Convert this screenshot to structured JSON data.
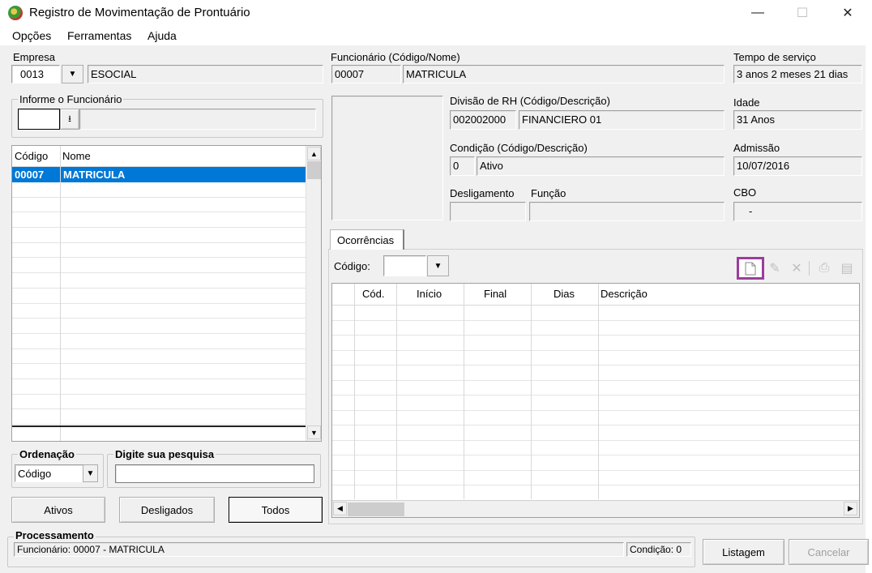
{
  "window": {
    "title": "Registro de Movimentação de Prontuário",
    "minimize": "—",
    "maximize": "☐",
    "close": "✕"
  },
  "menu": [
    "Opções",
    "Ferramentas",
    "Ajuda"
  ],
  "empresa": {
    "label": "Empresa",
    "code": "0013",
    "name": "ESOCIAL"
  },
  "informe": {
    "label": "Informe o Funcionário",
    "value": ""
  },
  "employee_list": {
    "headers": [
      "Código",
      "Nome"
    ],
    "rows": [
      {
        "codigo": "00007",
        "nome": "MATRICULA"
      }
    ]
  },
  "ordenacao": {
    "label": "Ordenação",
    "value": "Código"
  },
  "pesquisa": {
    "label": "Digite sua pesquisa",
    "value": ""
  },
  "filter_buttons": {
    "ativos": "Ativos",
    "desligados": "Desligados",
    "todos": "Todos"
  },
  "funcionario": {
    "label": "Funcionário (Código/Nome)",
    "code": "00007",
    "name": "MATRICULA"
  },
  "tempo_servico": {
    "label": "Tempo de serviço",
    "value": "3 anos 2 meses 21 dias"
  },
  "divisao": {
    "label": "Divisão de RH (Código/Descrição)",
    "code": "002002000",
    "desc": "FINANCIERO 01"
  },
  "idade": {
    "label": "Idade",
    "value": "31 Anos"
  },
  "condicao": {
    "label": "Condição (Código/Descrição)",
    "code": "0",
    "desc": "Ativo"
  },
  "admissao": {
    "label": "Admissão",
    "value": "10/07/2016"
  },
  "desligamento": {
    "label": "Desligamento",
    "value": ""
  },
  "funcao": {
    "label": "Função",
    "value": ""
  },
  "cbo": {
    "label": "CBO",
    "value": "-"
  },
  "ocorrencias": {
    "tab": "Ocorrências",
    "codigo_label": "Código:",
    "codigo_value": "",
    "headers": [
      "",
      "Cód.",
      "Início",
      "Final",
      "Dias",
      "Descrição"
    ]
  },
  "toolbar_icons": [
    "new-document-icon",
    "edit-pencil-icon",
    "delete-x-icon",
    "print-icon",
    "export-icon"
  ],
  "processamento": {
    "label": "Processamento",
    "status": "Funcionário: 00007 - MATRICULA",
    "condicao": "Condição: 0"
  },
  "actions": {
    "listagem": "Listagem",
    "cancelar": "Cancelar"
  },
  "colors": {
    "selection": "#0078d7",
    "highlight_border": "#9b3d9b"
  }
}
